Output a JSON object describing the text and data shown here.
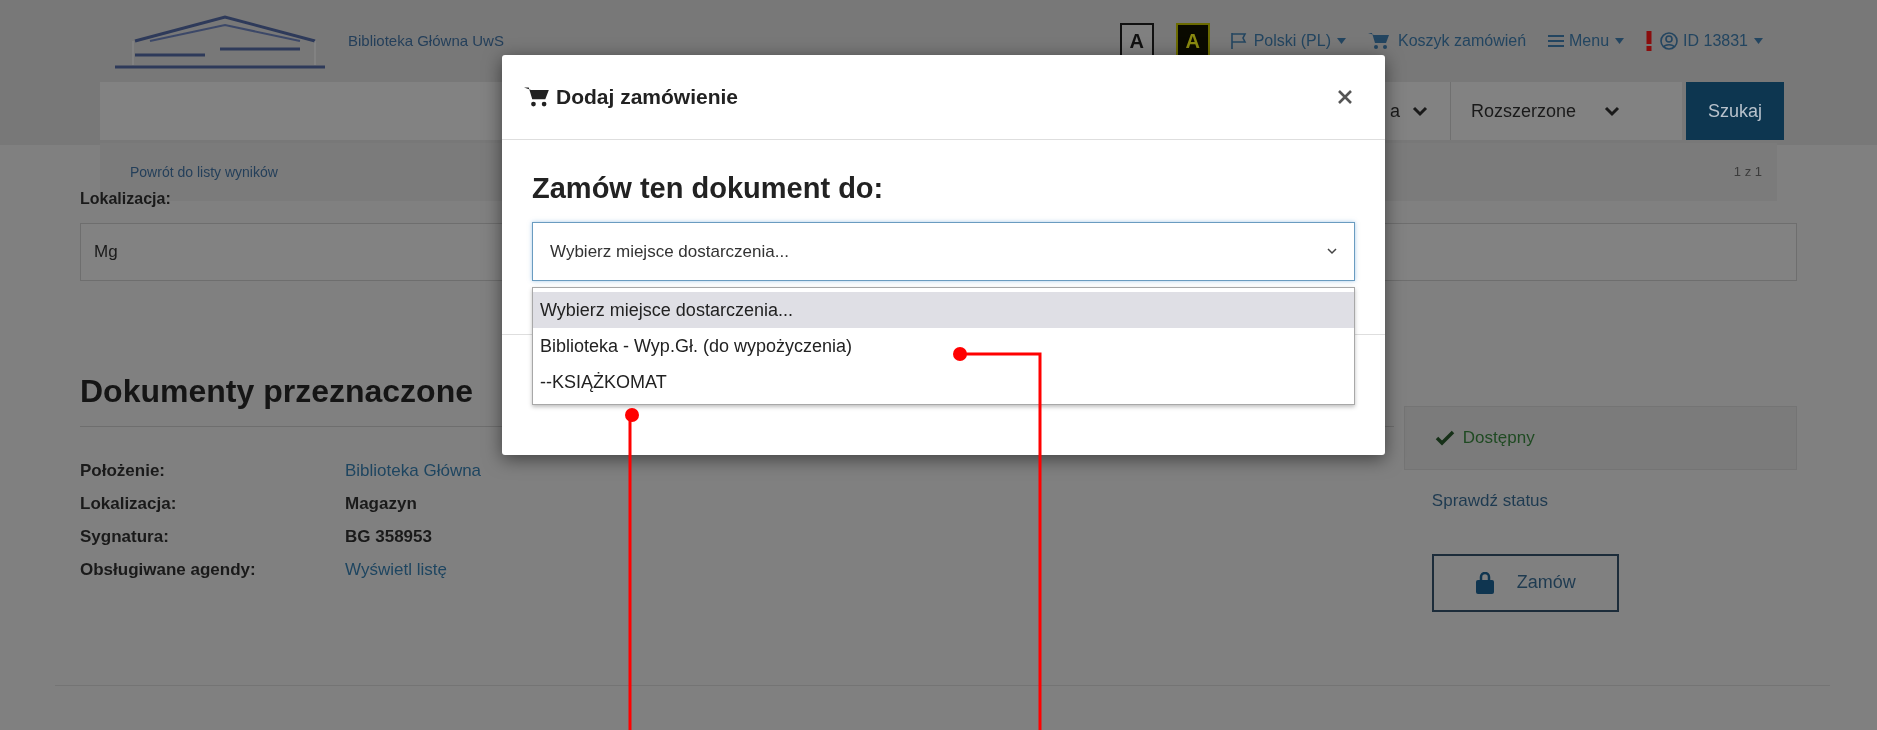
{
  "header": {
    "site_name": "Biblioteka Główna UwS",
    "contrast_buttons": [
      {
        "label": "A",
        "kind": "normal"
      },
      {
        "label": "A",
        "kind": "high"
      }
    ],
    "nav": [
      {
        "label": "Polski (PL)",
        "kind": "language",
        "dropdown": true
      },
      {
        "label": "Koszyk zamówień",
        "kind": "cart",
        "dropdown": false
      },
      {
        "label": "Menu",
        "kind": "menu",
        "dropdown": true
      },
      {
        "label": "ID 13831",
        "kind": "user",
        "dropdown": true
      }
    ]
  },
  "search": {
    "filters": [
      {
        "label": "a"
      },
      {
        "label": "Rozszerzone"
      }
    ],
    "button": "Szukaj"
  },
  "results_bar": {
    "back_link": "Powrót do listy wyników",
    "counter": "1 z 1"
  },
  "location": {
    "label": "Lokalizacja:",
    "value": "Mg"
  },
  "section": {
    "title": "Dokumenty przeznaczone",
    "details": [
      {
        "label": "Położenie:",
        "value": "Biblioteka Główna",
        "link": true
      },
      {
        "label": "Lokalizacja:",
        "value": "Magazyn",
        "link": false
      },
      {
        "label": "Sygnatura:",
        "value": "BG 358953",
        "link": false
      },
      {
        "label": "Obsługiwane agendy:",
        "value": "Wyświetl listę",
        "link": true
      }
    ],
    "status": "Dostępny",
    "check_link": "Sprawdź status",
    "order_button": "Zamów"
  },
  "modal": {
    "title": "Dodaj zamówienie",
    "heading": "Zamów ten dokument do:",
    "select": {
      "value": "Wybierz miejsce dostarczenia...",
      "options": [
        {
          "label": "Wybierz miejsce dostarczenia...",
          "selected": true,
          "callout": false
        },
        {
          "label": "Biblioteka - Wyp.Gł. (do wypożyczenia)",
          "selected": false,
          "callout": true
        },
        {
          "label": "--KSIĄŻKOMAT",
          "selected": false,
          "callout": true
        }
      ]
    }
  }
}
